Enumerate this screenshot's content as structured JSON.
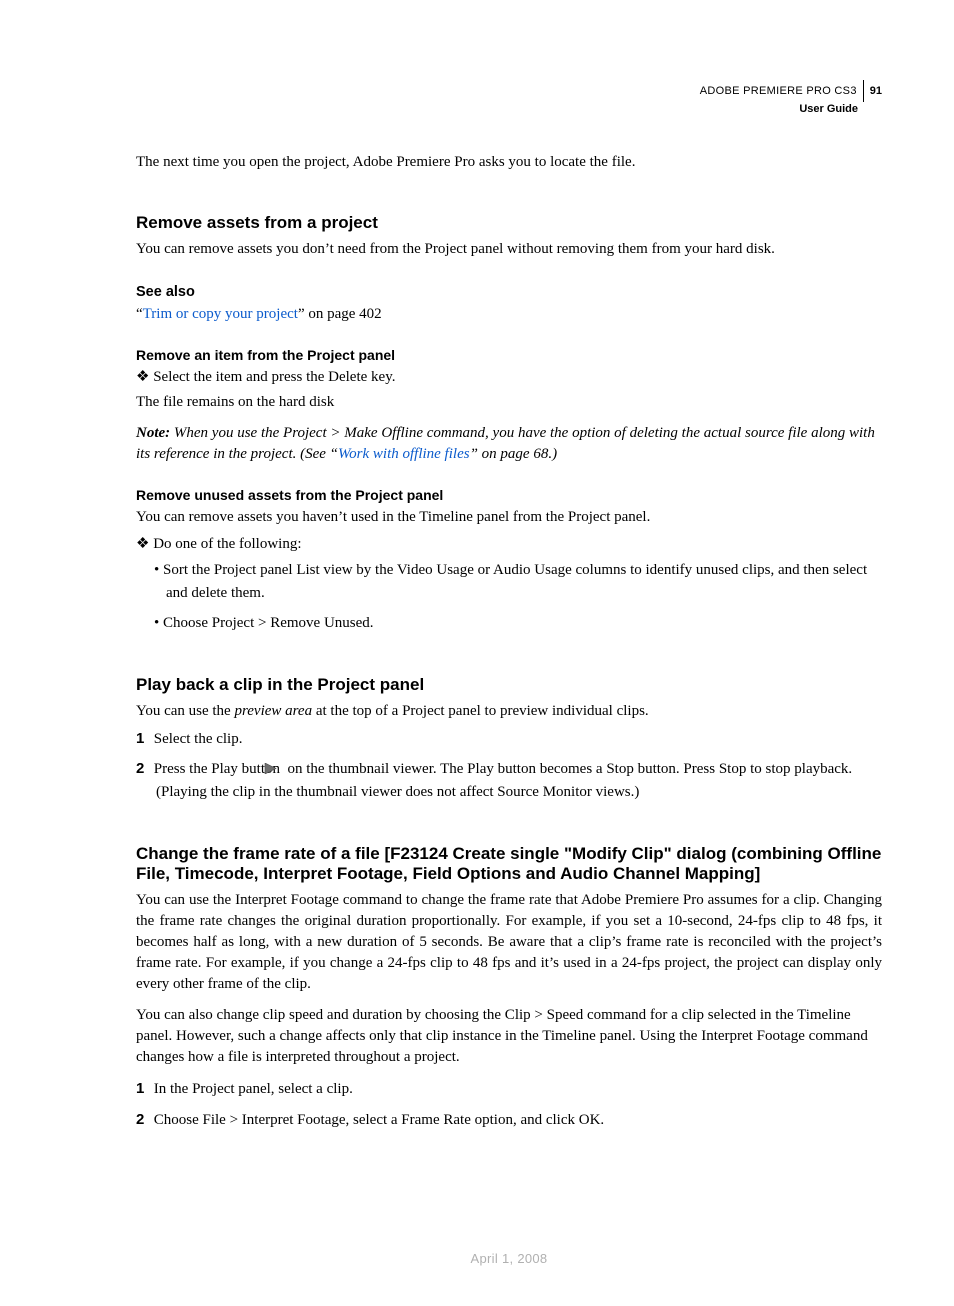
{
  "header": {
    "product": "ADOBE PREMIERE PRO CS3",
    "page_number": "91",
    "subtitle": "User Guide"
  },
  "intro_para": "The next time you open the project, Adobe Premiere Pro asks you to locate the file.",
  "section_remove": {
    "heading": "Remove assets from a project",
    "body": "You can remove assets you don’t need from the Project panel without removing them from your hard disk.",
    "see_also_heading": "See also",
    "see_also_quote_open": "“",
    "see_also_link": "Trim or copy your project",
    "see_also_tail": "” on page 402",
    "proc1": {
      "heading": "Remove an item from the Project panel",
      "step": "Select the item and press the Delete key.",
      "after": "The file remains on the hard disk",
      "note_label": "Note:",
      "note_body_1": " When you use the Project > Make Offline command, you have the option of deleting the actual source file along with its reference in the project. (See “",
      "note_link": "Work with offline files",
      "note_body_2": "” on page 68.)"
    },
    "proc2": {
      "heading": "Remove unused assets from the Project panel",
      "body": "You can remove assets you haven’t used in the Timeline panel from the Project panel.",
      "do_one": "Do one of the following:",
      "bullets": [
        "Sort the Project panel List view by the Video Usage or Audio Usage columns to identify unused clips, and then select and delete them.",
        "Choose Project > Remove Unused."
      ]
    }
  },
  "section_playback": {
    "heading": "Play back a clip in the Project panel",
    "body_pre": "You can use the ",
    "body_em": "preview area",
    "body_post": " at the top of a Project panel to preview individual clips.",
    "step1_num": "1",
    "step1": "Select the clip.",
    "step2_num": "2",
    "step2_pre": "Press the Play button ",
    "step2_post": " on the thumbnail viewer. The Play button becomes a Stop button. Press Stop to stop playback. (Playing the clip in the thumbnail viewer does not affect Source Monitor views.)"
  },
  "section_framerate": {
    "heading": "Change the frame rate of a file [F23124 Create single \"Modify Clip\" dialog (combining Offline File, Timecode, Interpret Footage, Field Options and Audio Channel Mapping]",
    "p1": "You can use the Interpret Footage command to change the frame rate that Adobe Premiere Pro assumes for a clip. Changing the frame rate changes the original duration proportionally. For example, if you set a 10-second, 24-fps clip to 48 fps, it becomes half as long, with a new duration of 5 seconds. Be aware that a clip’s frame rate is reconciled with the project’s frame rate. For example, if you change a 24-fps clip to 48 fps and it’s used in a 24-fps project, the project can display only every other frame of the clip.",
    "p2": "You can also change clip speed and duration by choosing the Clip > Speed command for a clip selected in the Timeline panel. However, such a change affects only that clip instance in the Timeline panel. Using the Interpret Footage command changes how a file is interpreted throughout a project.",
    "step1_num": "1",
    "step1": "In the Project panel, select a clip.",
    "step2_num": "2",
    "step2": "Choose File > Interpret Footage, select a Frame Rate option, and click OK."
  },
  "footer_date": "April 1, 2008"
}
